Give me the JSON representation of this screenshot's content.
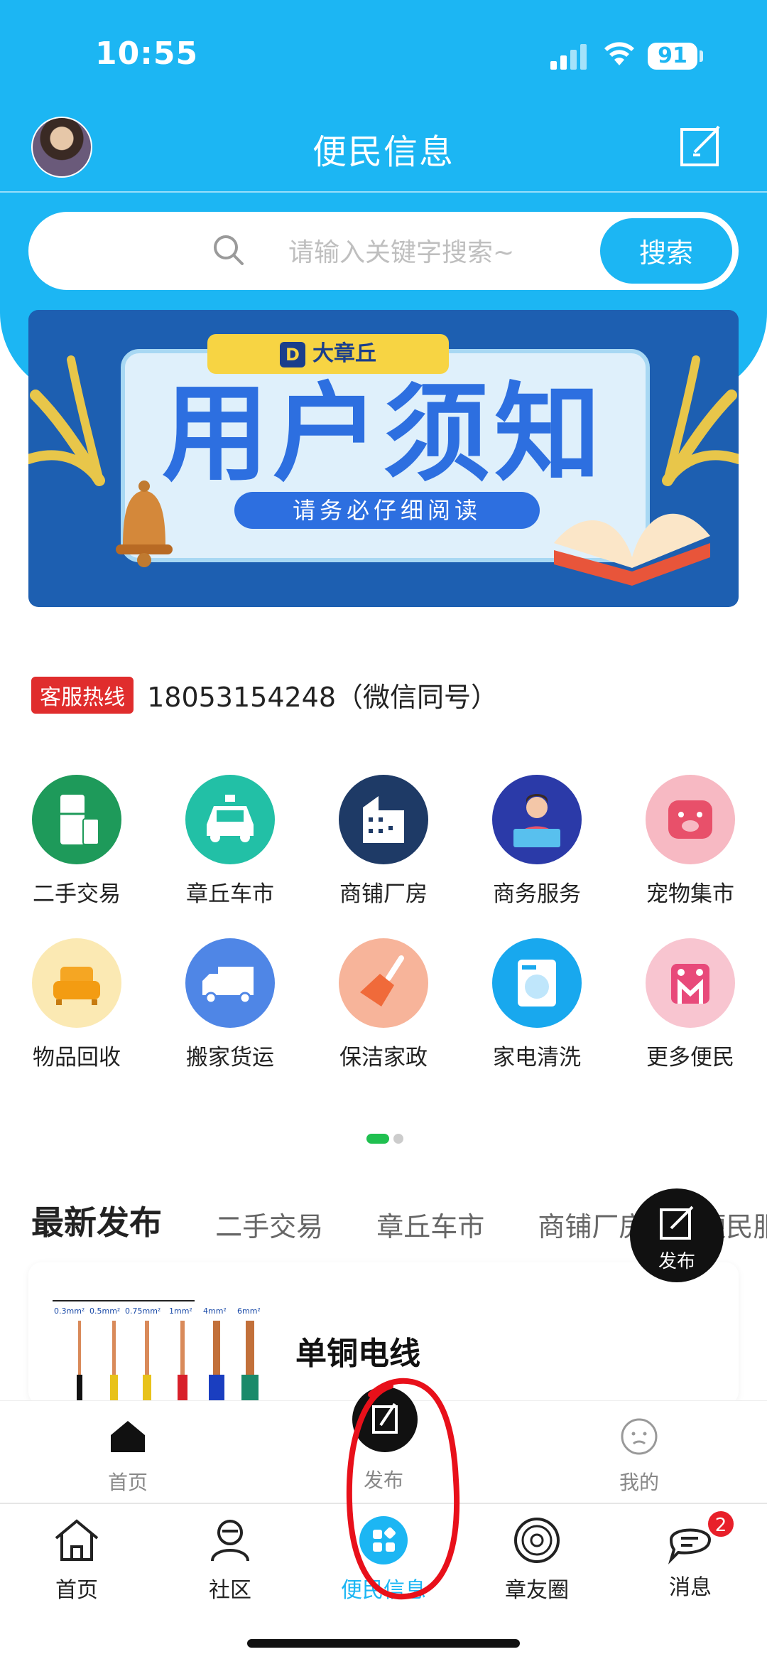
{
  "status_bar": {
    "time": "10:55",
    "battery": "91"
  },
  "header": {
    "title": "便民信息"
  },
  "search": {
    "placeholder": "请输入关键字搜索~",
    "button": "搜索"
  },
  "banner": {
    "brand": "大章丘",
    "title": "用户须知",
    "subtitle": "请务必仔细阅读"
  },
  "hotline": {
    "tag": "客服热线",
    "number": "18053154248（微信同号）"
  },
  "categories": [
    {
      "label": "二手交易",
      "icon": "fridge-icon",
      "color": "#1e9a5a"
    },
    {
      "label": "章丘车市",
      "icon": "taxi-icon",
      "color": "#22c0a6"
    },
    {
      "label": "商铺厂房",
      "icon": "building-icon",
      "color": "#1e3a66"
    },
    {
      "label": "商务服务",
      "icon": "business-person-icon",
      "color": "#2b3aa8"
    },
    {
      "label": "宠物集市",
      "icon": "pig-icon",
      "color": "#f7b9c3"
    },
    {
      "label": "物品回收",
      "icon": "sofa-icon",
      "color": "#fbe9b3"
    },
    {
      "label": "搬家货运",
      "icon": "truck-icon",
      "color": "#4f86e6"
    },
    {
      "label": "保洁家政",
      "icon": "broom-icon",
      "color": "#f7b49a"
    },
    {
      "label": "家电清洗",
      "icon": "washing-machine-icon",
      "color": "#18a8ee"
    },
    {
      "label": "更多便民",
      "icon": "more-icon",
      "color": "#f8c5d0"
    }
  ],
  "latest": {
    "title": "最新发布",
    "tabs": [
      "二手交易",
      "章丘车市",
      "商铺厂房",
      "便民服"
    ],
    "fab_label": "发布",
    "card_title": "单铜电线",
    "wire_labels": [
      "0.3mm²",
      "0.5mm²",
      "0.75mm²",
      "1mm²",
      "4mm²",
      "6mm²"
    ]
  },
  "inner_bar": {
    "home": "首页",
    "publish": "发布",
    "mine": "我的"
  },
  "tabbar": {
    "items": [
      {
        "label": "首页"
      },
      {
        "label": "社区"
      },
      {
        "label": "便民信息"
      },
      {
        "label": "章友圈"
      },
      {
        "label": "消息",
        "badge": "2"
      }
    ]
  },
  "colors": {
    "accent": "#1cb6f3",
    "hotline": "#e02d2d",
    "badge": "#e8202a"
  }
}
